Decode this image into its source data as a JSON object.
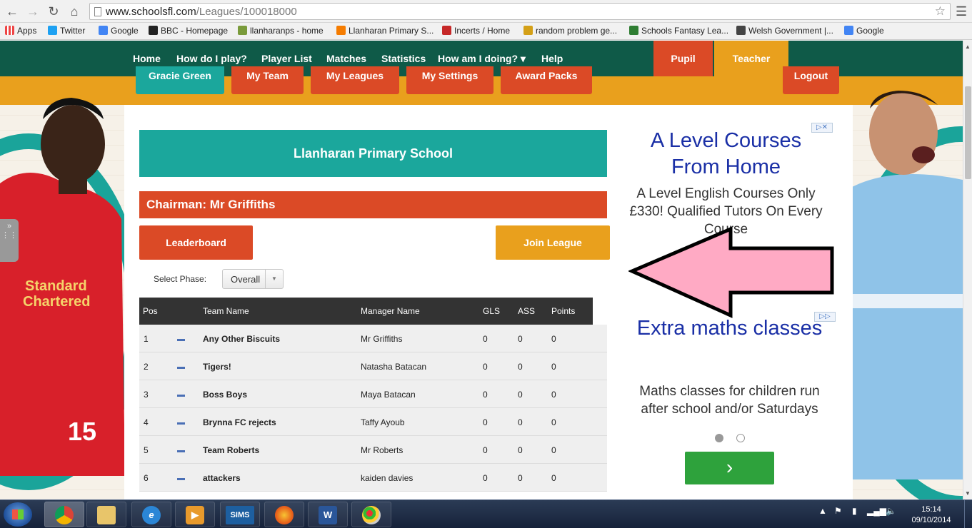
{
  "browser": {
    "url_domain": "www.schoolsfl.com",
    "url_path": "/Leagues/100018000",
    "bookmarks": [
      {
        "label": "Apps",
        "color": "#4285f4"
      },
      {
        "label": "Twitter",
        "color": "#1da1f2"
      },
      {
        "label": "Google",
        "color": "#4285f4"
      },
      {
        "label": "BBC - Homepage",
        "color": "#222222"
      },
      {
        "label": "llanharanps - home",
        "color": "#7a9b3b"
      },
      {
        "label": "Llanharan Primary S...",
        "color": "#f57c00"
      },
      {
        "label": "Incerts / Home",
        "color": "#c62828"
      },
      {
        "label": "random problem ge...",
        "color": "#d4a017"
      },
      {
        "label": "Schools Fantasy Lea...",
        "color": "#2e7d32"
      },
      {
        "label": "Welsh Government |...",
        "color": "#444444"
      },
      {
        "label": "Google",
        "color": "#4285f4"
      }
    ]
  },
  "site_nav": {
    "items": [
      "Home",
      "How do I play?",
      "Player List",
      "Matches",
      "Statistics",
      "How am I doing? ▾",
      "Help"
    ],
    "pupil": "Pupil",
    "teacher": "Teacher"
  },
  "sub_tabs": [
    "Gracie Green",
    "My Team",
    "My Leagues",
    "My Settings",
    "Award Packs",
    "Logout"
  ],
  "league": {
    "school": "Llanharan Primary School",
    "chairman": "Chairman: Mr Griffiths",
    "leaderboard_label": "Leaderboard",
    "join_label": "Join League",
    "phase_label": "Select Phase:",
    "phase_value": "Overall"
  },
  "table": {
    "headers": [
      "Pos",
      "Team Name",
      "Manager Name",
      "GLS",
      "ASS",
      "Points"
    ],
    "rows": [
      {
        "pos": "1",
        "team": "Any Other Biscuits",
        "manager": "Mr Griffiths",
        "gls": "0",
        "ass": "0",
        "points": "0"
      },
      {
        "pos": "2",
        "team": "Tigers!",
        "manager": "Natasha Batacan",
        "gls": "0",
        "ass": "0",
        "points": "0"
      },
      {
        "pos": "3",
        "team": "Boss Boys",
        "manager": "Maya Batacan",
        "gls": "0",
        "ass": "0",
        "points": "0"
      },
      {
        "pos": "4",
        "team": "Brynna FC rejects",
        "manager": "Taffy Ayoub",
        "gls": "0",
        "ass": "0",
        "points": "0"
      },
      {
        "pos": "5",
        "team": "Team Roberts",
        "manager": "Mr Roberts",
        "gls": "0",
        "ass": "0",
        "points": "0"
      },
      {
        "pos": "6",
        "team": "attackers",
        "manager": "kaiden davies",
        "gls": "0",
        "ass": "0",
        "points": "0"
      }
    ]
  },
  "ads": {
    "ad1_title": "A Level Courses From Home",
    "ad1_body": "A Level English Courses Only £330! Qualified Tutors On Every Course",
    "ad2_title": "Extra maths classes",
    "ad2_body": "Maths classes for children run after school and/or Saturdays",
    "go_glyph": "›"
  },
  "player_left": {
    "sponsor_line1": "Standard",
    "sponsor_line2": "Chartered",
    "number": "15"
  },
  "taskbar": {
    "sims_label": "SIMS",
    "time": "15:14",
    "date": "09/10/2014"
  },
  "colors": {
    "nav_green": "#0f5a48",
    "orange_red": "#db4a26",
    "amber": "#e9a01d",
    "teal": "#1ba79c",
    "pink_arrow": "#ffaac4"
  }
}
